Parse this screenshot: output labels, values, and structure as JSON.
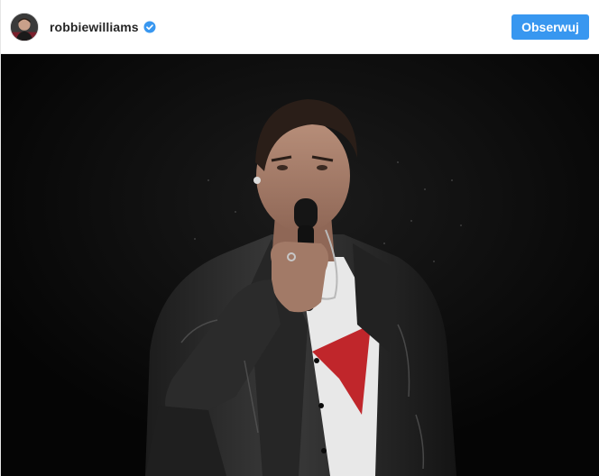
{
  "header": {
    "avatar_icon": "user-avatar-photo",
    "username": "robbiewilliams",
    "verified_icon": "verified-badge-icon",
    "follow_label": "Obserwuj"
  },
  "colors": {
    "follow_button": "#3897f0",
    "verified_badge": "#3897f0",
    "photo_background": "#070707"
  },
  "photo": {
    "subject": "singer-on-stage-with-microphone"
  }
}
